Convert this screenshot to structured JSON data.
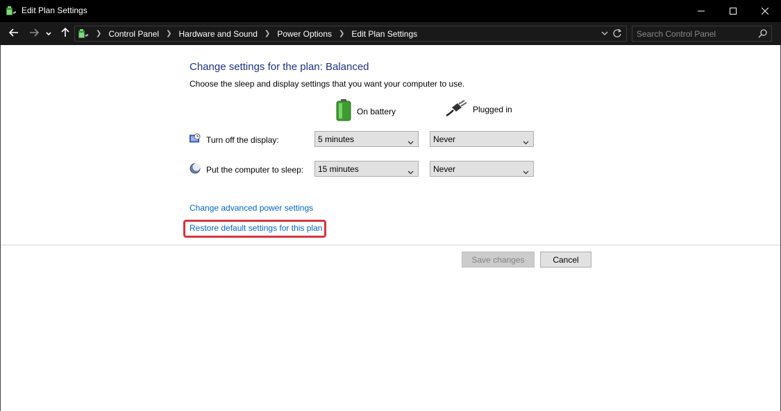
{
  "window": {
    "title": "Edit Plan Settings"
  },
  "address_bar": {
    "breadcrumbs": [
      "Control Panel",
      "Hardware and Sound",
      "Power Options",
      "Edit Plan Settings"
    ]
  },
  "search": {
    "placeholder": "Search Control Panel"
  },
  "main": {
    "heading": "Change settings for the plan: Balanced",
    "description": "Choose the sleep and display settings that you want your computer to use.",
    "columns": {
      "on_battery": "On battery",
      "plugged_in": "Plugged in"
    },
    "settings": [
      {
        "label": "Turn off the display:",
        "on_battery": "5 minutes",
        "plugged_in": "Never"
      },
      {
        "label": "Put the computer to sleep:",
        "on_battery": "15 minutes",
        "plugged_in": "Never"
      }
    ],
    "links": {
      "advanced": "Change advanced power settings",
      "restore": "Restore default settings for this plan"
    },
    "buttons": {
      "save": "Save changes",
      "cancel": "Cancel"
    }
  },
  "colors": {
    "heading": "#1e3287",
    "link": "#0066cc",
    "highlight": "#d9333f",
    "titlebar": "#000000",
    "addressbar": "#191919"
  },
  "icons": [
    "power-options-icon",
    "minimize-icon",
    "maximize-icon",
    "close-icon",
    "back-arrow-icon",
    "forward-arrow-icon",
    "recent-dropdown-icon",
    "up-arrow-icon",
    "chevron-right-icon",
    "refresh-icon",
    "search-icon",
    "battery-icon",
    "plug-icon",
    "display-icon",
    "sleep-moon-icon",
    "dropdown-arrow-icon"
  ]
}
